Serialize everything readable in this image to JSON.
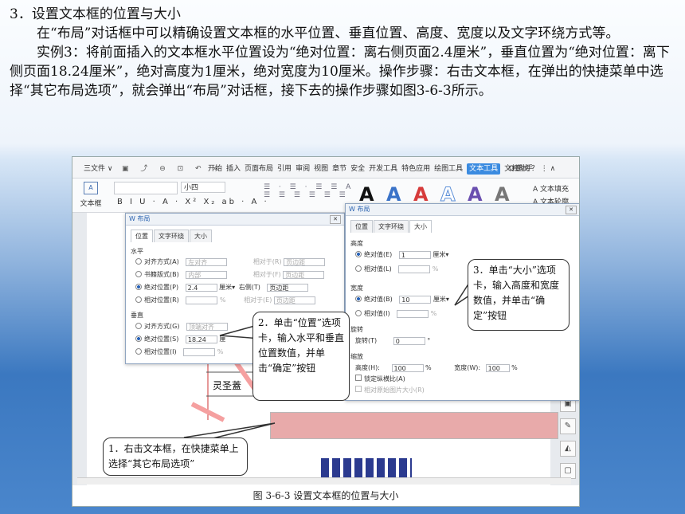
{
  "slide": {
    "heading": "3．设置文本框的位置与大小",
    "para1": "在“布局”对话框中可以精确设置文本框的水平位置、垂直位置、高度、宽度以及文字环绕方式等。",
    "para2": "实例3：将前面插入的文本框水平位置设为“绝对位置：离右侧页面2.4厘米”，垂直位置为“绝对位置：离下侧页面18.24厘米”，绝对高度为1厘米，绝对宽度为10厘米。操作步骤：右击文本框，在弹出的快捷菜单中选择“其它布局选项”，就会弹出“布局”对话框，接下去的操作步骤如图3-6-3所示。"
  },
  "menubar": {
    "file": "三文件 ∨",
    "icons": "▣ ⤴ ⊖ ⊡ ↶ »",
    "tabs": [
      "开始",
      "插入",
      "页面布局",
      "引用",
      "审阅",
      "视图",
      "章节",
      "安全",
      "开发工具",
      "特色应用",
      "绘图工具"
    ],
    "active_tab": "文本工具",
    "tab_after": "文档助手",
    "search": "Q查找 ？ ⋮ ∧"
  },
  "ribbon": {
    "textbox_label": "文本框",
    "textbox_icon_text": "A",
    "font_size": "小四",
    "format_row": "B I U · A · X² X₂ ab · A ·",
    "para_row1": "☰ · ☰ · ☰ ☰ A",
    "para_row2": "☰ ☰ ☰ ☰ ☰ ☰",
    "style_letter": "A",
    "fill_label": "A 文本填充",
    "outline_label": "A 文本轮廓"
  },
  "dialog1": {
    "title": "W 布局",
    "tabs": [
      "位置",
      "文字环绕",
      "大小"
    ],
    "horizontal": "水平",
    "h_rows": [
      {
        "label": "对齐方式(A)",
        "value": "左对齐",
        "rel_label": "相对于(R)",
        "rel_value": "页边距"
      },
      {
        "label": "书籍版式(B)",
        "value": "内部",
        "rel_label": "相对于(F)",
        "rel_value": "页边距"
      },
      {
        "label": "绝对位置(P)",
        "value": "2.4",
        "unit": "厘米▾",
        "rel_label": "右侧(T)",
        "rel_value": "页边距"
      },
      {
        "label": "相对位置(R)",
        "value": "",
        "unit": "%",
        "rel_label": "相对于(E)",
        "rel_value": "页边距"
      }
    ],
    "vertical": "垂直",
    "v_rows": [
      {
        "label": "对齐方式(G)",
        "value": "顶端对齐"
      },
      {
        "label": "绝对位置(S)",
        "value": "18.24",
        "unit": "厘"
      },
      {
        "label": "相对位置(I)",
        "value": "",
        "unit": "%"
      }
    ]
  },
  "dialog2": {
    "title": "W 布局",
    "tabs": [
      "位置",
      "文字环绕",
      "大小"
    ],
    "height": "高度",
    "h_rows": [
      {
        "label": "绝对值(E)",
        "value": "1",
        "unit": "厘米▾"
      },
      {
        "label": "相对值(L)",
        "value": "",
        "unit": "%"
      }
    ],
    "width": "宽度",
    "w_rows": [
      {
        "label": "绝对值(B)",
        "value": "10",
        "unit": "厘米▾"
      },
      {
        "label": "相对值(I)",
        "value": "",
        "unit": "%"
      }
    ],
    "rotate": "旋转",
    "rotate_label": "旋转(T)",
    "rotate_value": "0",
    "rotate_unit": "°",
    "scale": "缩放",
    "scale_h_label": "高度(H):",
    "scale_h_value": "100",
    "scale_w_label": "宽度(W):",
    "scale_w_value": "100",
    "pct": "%",
    "lock_ratio": "锁定纵横比(A)",
    "relative_orig": "相对原始图片大小(R)"
  },
  "callouts": {
    "step1": "1．右击文本框，在快捷菜单上选择“其它布局选项”",
    "step2": "2．单击“位置”选项卡，输入水平和垂直位置数值，并单击“确定”按钮",
    "step3": "3．单击“大小”选项卡，输入高度和宽度数值，并单击“确定”按钮"
  },
  "doc": {
    "text": "灵圣蓋"
  },
  "caption": "图 3-6-3  设置文本框的位置与大小",
  "colors": {
    "active_tab": "#3b8be0",
    "textbox_fill": "#e8aaaa",
    "dialog_border": "#8fa4c0"
  }
}
